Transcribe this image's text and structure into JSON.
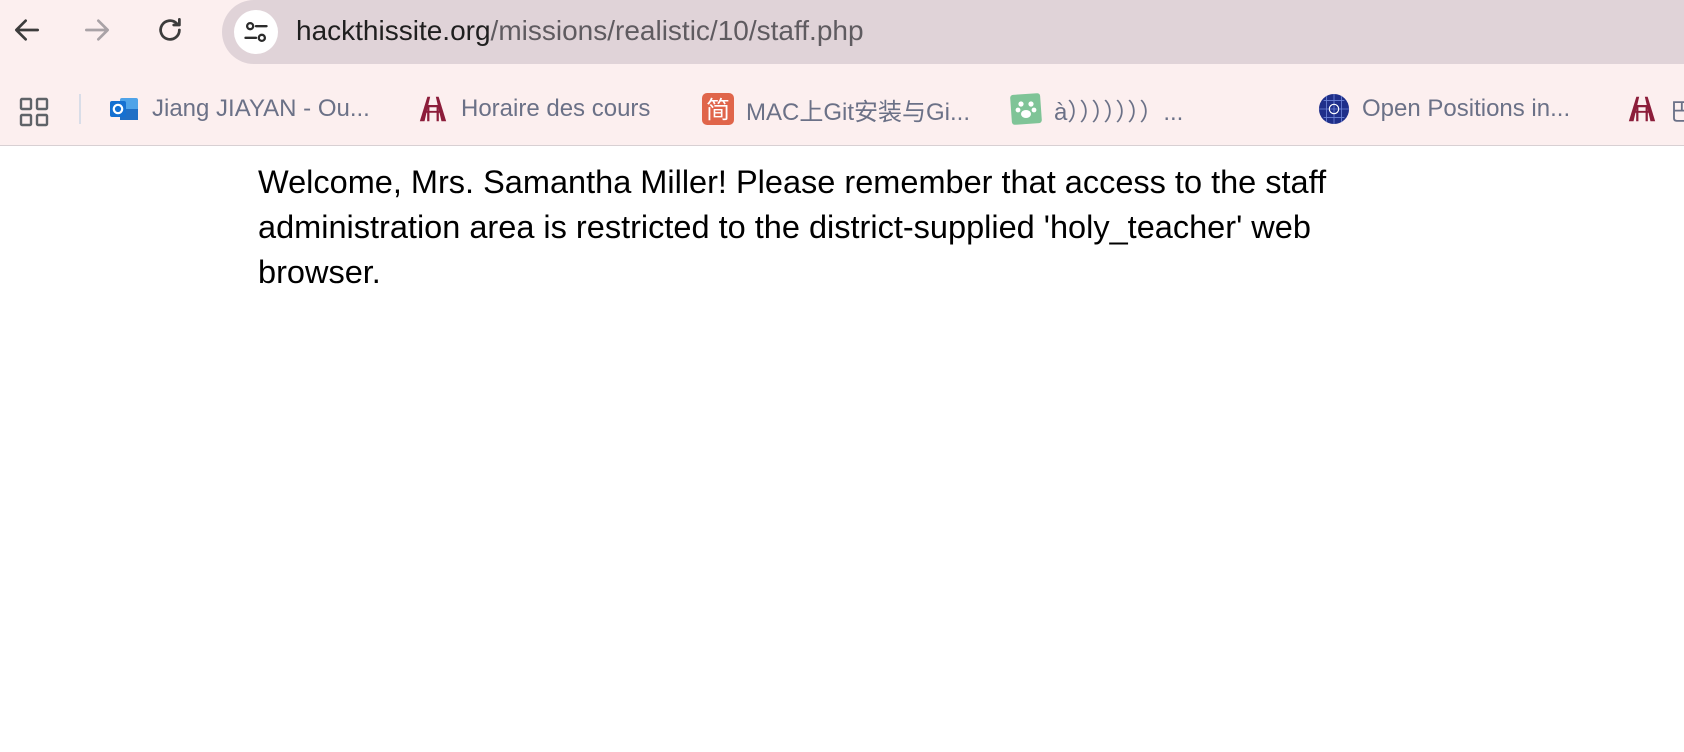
{
  "browser": {
    "url_host": "hackthissite.org",
    "url_path": "/missions/realistic/10/staff.php"
  },
  "bookmarks": [
    {
      "label": "Jiang JIAYAN - Ou...",
      "icon": "outlook-icon"
    },
    {
      "label": "Horaire des cours",
      "icon": "university-logo-icon"
    },
    {
      "label": "MAC上Git安装与Gi...",
      "icon": "jianshu-icon"
    },
    {
      "label": "à）））））））...",
      "icon": "paw-icon"
    },
    {
      "label": "Open Positions in...",
      "icon": "globe-grid-icon"
    },
    {
      "label": "巴",
      "icon": "university-logo-icon"
    }
  ],
  "page": {
    "message": "Welcome, Mrs. Samantha Miller! Please remember that access to the staff administration area is restricted to the district-supplied 'holy_teacher' web browser."
  },
  "colors": {
    "toolbar_bg": "#fcefef",
    "omnibox_bg": "#e0d3d8",
    "bookmark_text": "#6b7187",
    "outlook_blue": "#1570d1",
    "university_red": "#8c1d3a",
    "jianshu_orange": "#e0654a",
    "paw_green": "#7fc497",
    "globe_navy": "#1f2f8a"
  }
}
